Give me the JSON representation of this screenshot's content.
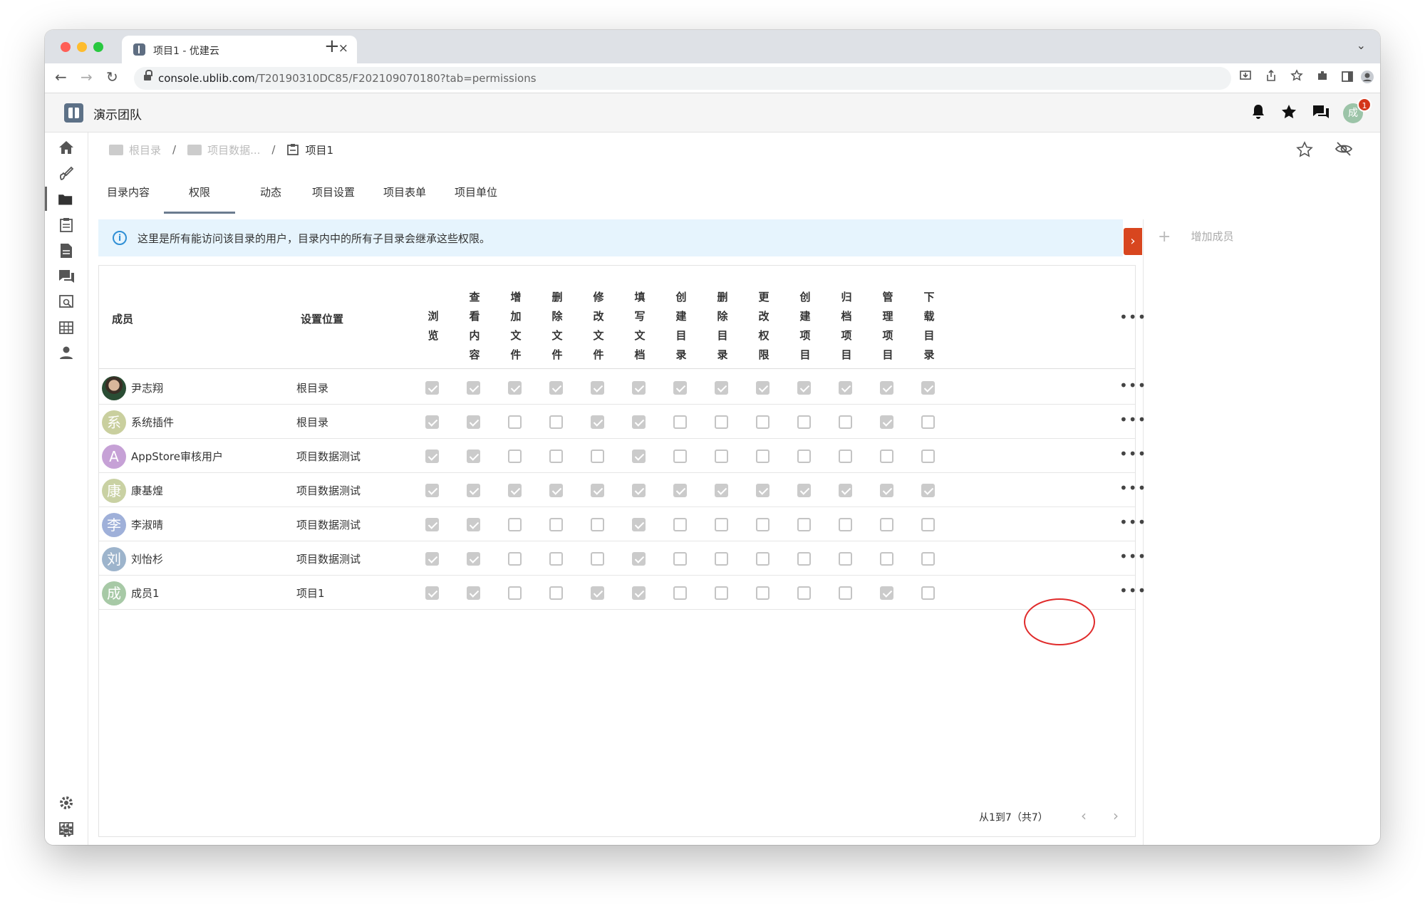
{
  "browser": {
    "tab_title": "项目1 - 优建云",
    "tab_close": "×",
    "new_tab": "+",
    "tab_menu": "⌄",
    "url_host": "console.ublib.com",
    "url_path": "/T20190310DC85/F202109070180?tab=permissions",
    "back": "←",
    "forward": "→",
    "reload": "↻"
  },
  "app": {
    "name": "演示团队",
    "avatar_text": "成",
    "notification_count": "1"
  },
  "breadcrumb": {
    "items": [
      "根目录",
      "项目数据...",
      "项目1"
    ],
    "separator": "/"
  },
  "tabs": [
    "目录内容",
    "权限",
    "动态",
    "项目设置",
    "项目表单",
    "项目单位"
  ],
  "active_tab": 1,
  "info": {
    "icon": "i",
    "text": "这里是所有能访问该目录的用户，目录内中的所有子目录会继承这些权限。"
  },
  "side_panel": {
    "add_member_label": "增加成员",
    "plus": "+"
  },
  "table": {
    "col_member": "成员",
    "col_location": "设置位置",
    "permission_columns": [
      [
        "浏",
        "览"
      ],
      [
        "查",
        "看",
        "内",
        "容"
      ],
      [
        "增",
        "加",
        "文",
        "件"
      ],
      [
        "删",
        "除",
        "文",
        "件"
      ],
      [
        "修",
        "改",
        "文",
        "件"
      ],
      [
        "填",
        "写",
        "文",
        "档"
      ],
      [
        "创",
        "建",
        "目",
        "录"
      ],
      [
        "删",
        "除",
        "目",
        "录"
      ],
      [
        "更",
        "改",
        "权",
        "限"
      ],
      [
        "创",
        "建",
        "项",
        "目"
      ],
      [
        "归",
        "档",
        "项",
        "目"
      ],
      [
        "管",
        "理",
        "项",
        "目"
      ],
      [
        "下",
        "载",
        "目",
        "录"
      ]
    ],
    "more": "•••",
    "rows": [
      {
        "avatar": "",
        "avatar_color": "#3a2e25",
        "photo": true,
        "name": "尹志翔",
        "location": "根目录",
        "perms": [
          1,
          1,
          1,
          1,
          1,
          1,
          1,
          1,
          1,
          1,
          1,
          1,
          1
        ]
      },
      {
        "avatar": "系",
        "avatar_color": "#c9cf9e",
        "photo": false,
        "name": "系统插件",
        "location": "根目录",
        "perms": [
          1,
          1,
          0,
          0,
          1,
          1,
          0,
          0,
          0,
          0,
          0,
          1,
          0
        ]
      },
      {
        "avatar": "A",
        "avatar_color": "#c6a1d6",
        "photo": false,
        "name": "AppStore审核用户",
        "location": "项目数据测试",
        "perms": [
          1,
          1,
          0,
          0,
          0,
          1,
          0,
          0,
          0,
          0,
          0,
          0,
          0
        ]
      },
      {
        "avatar": "康",
        "avatar_color": "#c9d1a3",
        "photo": false,
        "name": "康基煌",
        "location": "项目数据测试",
        "perms": [
          1,
          1,
          1,
          1,
          1,
          1,
          1,
          1,
          1,
          1,
          1,
          1,
          1
        ]
      },
      {
        "avatar": "李",
        "avatar_color": "#9fb0d9",
        "photo": false,
        "name": "李淑晴",
        "location": "项目数据测试",
        "perms": [
          1,
          1,
          0,
          0,
          0,
          1,
          0,
          0,
          0,
          0,
          0,
          0,
          0
        ]
      },
      {
        "avatar": "刘",
        "avatar_color": "#9db4cc",
        "photo": false,
        "name": "刘怡杉",
        "location": "项目数据测试",
        "perms": [
          1,
          1,
          0,
          0,
          0,
          1,
          0,
          0,
          0,
          0,
          0,
          0,
          0
        ]
      },
      {
        "avatar": "成",
        "avatar_color": "#a7c9a6",
        "photo": false,
        "name": "成员1",
        "location": "项目1",
        "perms": [
          1,
          1,
          0,
          0,
          1,
          1,
          0,
          0,
          0,
          0,
          0,
          1,
          0
        ]
      }
    ]
  },
  "pagination": {
    "text": "从1到7（共7）",
    "prev": "‹",
    "next": "›"
  },
  "colors": {
    "accent_orange": "#d8461f",
    "info_bg": "#e6f4fd",
    "highlight_red": "#e02b2b",
    "checkbox_checked": "#cbcbcb"
  },
  "icons": {
    "rail_top": [
      "home-icon",
      "brush-icon",
      "folder-icon",
      "clipboard-icon",
      "document-icon",
      "chat-icon",
      "search-doc-icon",
      "building-icon",
      "user-icon"
    ],
    "rail_bottom": [
      "gear-icon",
      "building-icon",
      "gear-icon"
    ]
  }
}
